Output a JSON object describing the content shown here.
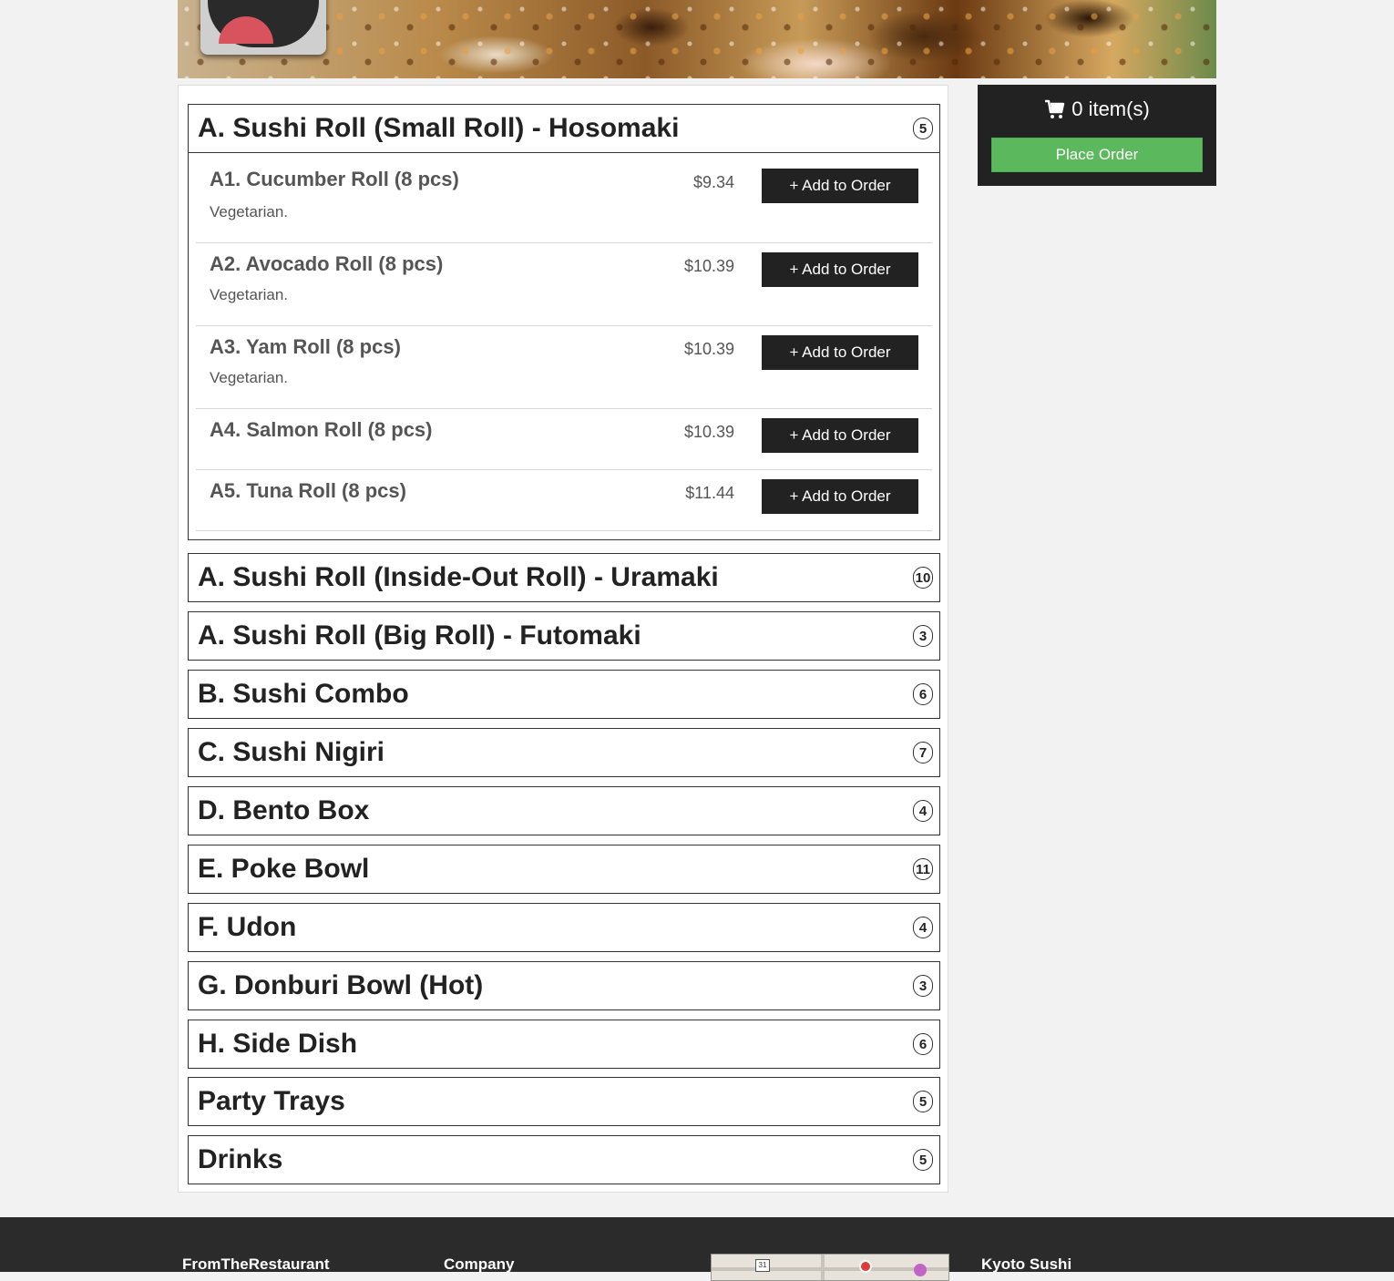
{
  "cart": {
    "count_text": "0 item(s)",
    "place_order_label": "Place Order"
  },
  "menu": {
    "open_category": {
      "title": "A. Sushi Roll (Small Roll) - Hosomaki",
      "count": "5",
      "items": [
        {
          "name": "A1. Cucumber Roll (8 pcs)",
          "price": "$9.34",
          "description": "Vegetarian.",
          "button": "+ Add to Order"
        },
        {
          "name": "A2. Avocado Roll (8 pcs)",
          "price": "$10.39",
          "description": "Vegetarian.",
          "button": "+ Add to Order"
        },
        {
          "name": "A3. Yam Roll (8 pcs)",
          "price": "$10.39",
          "description": "Vegetarian.",
          "button": "+ Add to Order"
        },
        {
          "name": "A4. Salmon Roll (8 pcs)",
          "price": "$10.39",
          "description": "",
          "button": "+ Add to Order"
        },
        {
          "name": "A5. Tuna Roll (8 pcs)",
          "price": "$11.44",
          "description": "",
          "button": "+ Add to Order"
        }
      ]
    },
    "categories": [
      {
        "title": "A. Sushi Roll (Inside-Out Roll) - Uramaki",
        "count": "10"
      },
      {
        "title": "A. Sushi Roll (Big Roll) - Futomaki",
        "count": "3"
      },
      {
        "title": "B. Sushi Combo",
        "count": "6"
      },
      {
        "title": "C. Sushi Nigiri",
        "count": "7"
      },
      {
        "title": "D. Bento Box",
        "count": "4"
      },
      {
        "title": "E. Poke Bowl",
        "count": "11"
      },
      {
        "title": "F. Udon",
        "count": "4"
      },
      {
        "title": "G. Donburi Bowl (Hot)",
        "count": "3"
      },
      {
        "title": "H. Side Dish",
        "count": "6"
      },
      {
        "title": "Party Trays",
        "count": "5"
      },
      {
        "title": "Drinks",
        "count": "5"
      }
    ]
  },
  "footer": {
    "col1_heading": "FromTheRestaurant",
    "col2_heading": "Company",
    "col4_heading": "Kyoto Sushi",
    "map_route_label": "31"
  },
  "colors": {
    "place_order_green": "#5cb85c",
    "dark": "#222222"
  }
}
